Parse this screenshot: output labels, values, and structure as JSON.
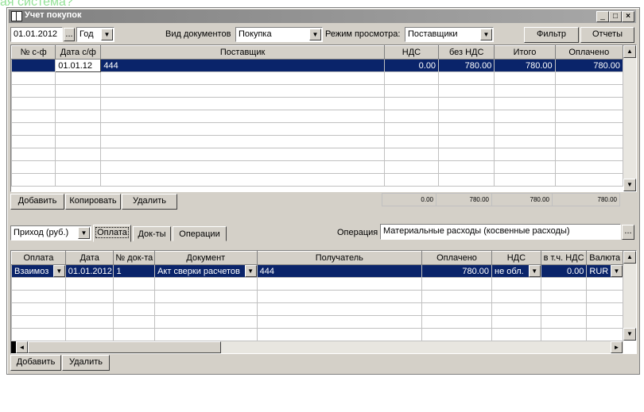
{
  "background_text": "ая система?",
  "window": {
    "title": "Учет покупок",
    "controls": [
      "_",
      "□",
      "×"
    ]
  },
  "toolbar": {
    "date": "01.01.2012",
    "date_btn": "...",
    "period": "Год",
    "doc_type_label": "Вид документов",
    "doc_type": "Покупка",
    "view_mode_label": "Режим просмотра:",
    "view_mode": "Поставщики",
    "filter_button": "Фильтр",
    "reports_button": "Отчеты"
  },
  "top_grid": {
    "columns": [
      "№ с-ф",
      "Дата с/ф",
      "Поставщик",
      "НДС",
      "без НДС",
      "Итого",
      "Оплачено"
    ],
    "rows": [
      {
        "num": "",
        "date": "01.01.12",
        "supplier": "444",
        "vat": "0.00",
        "no_vat": "780.00",
        "total": "780.00",
        "paid": "780.00"
      }
    ],
    "empty_rows": 9,
    "totals": {
      "vat": "0.00",
      "no_vat": "780.00",
      "total": "780.00",
      "paid": "780.00"
    }
  },
  "top_buttons": {
    "add": "Добавить",
    "copy": "Копировать",
    "delete": "Удалить"
  },
  "bottom_panel": {
    "income": "Приход (руб.)",
    "tabs": [
      "Оплата",
      "Док-ты",
      "Операции"
    ],
    "active_tab": 0,
    "operation_label": "Операция",
    "operation": "Материальные расходы (косвенные расходы)",
    "operation_btn": "..."
  },
  "bottom_grid": {
    "columns": [
      "Оплата",
      "Дата",
      "№ док-та",
      "Документ",
      "Получатель",
      "Оплачено",
      "НДС",
      "в т.ч. НДС",
      "Валюта"
    ],
    "rows": [
      {
        "payment": "Взаимоз",
        "date": "01.01.2012",
        "docnum": "1",
        "document": "Акт сверки расчетов",
        "recipient": "444",
        "paid": "780.00",
        "vat": "не обл.",
        "incl_vat": "0.00",
        "currency": "RUR"
      }
    ],
    "empty_rows": 5
  },
  "bottom_buttons": {
    "add": "Добавить",
    "delete": "Удалить"
  }
}
